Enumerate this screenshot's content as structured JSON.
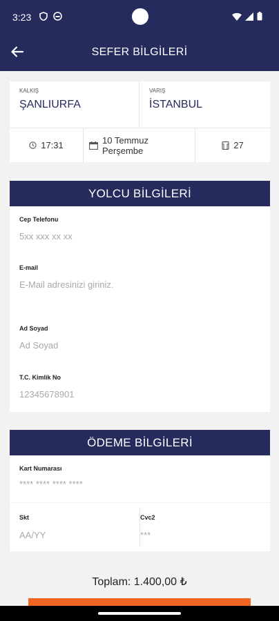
{
  "status_bar": {
    "time": "3:23"
  },
  "app_bar": {
    "title": "SEFER BİLGİLERİ"
  },
  "trip": {
    "from_label": "KALKIŞ",
    "from_city": "ŞANLIURFA",
    "to_label": "VARIŞ",
    "to_city": "İSTANBUL",
    "time": "17:31",
    "date_line1": "10 Temmuz",
    "date_line2": "Perşembe",
    "seat": "27"
  },
  "passenger": {
    "header": "YOLCU BİLGİLERİ",
    "phone_label": "Cep Telefonu",
    "phone_placeholder": "5xx xxx xx xx",
    "email_label": "E-mail",
    "email_placeholder": "E-Mail adresinizi giriniz.",
    "name_label": "Ad Soyad",
    "name_placeholder": "Ad Soyad",
    "tc_label": "T.C. Kimlik No",
    "tc_placeholder": "12345678901"
  },
  "payment": {
    "header": "ÖDEME BİLGİLERİ",
    "card_label": "Kart Numarası",
    "card_placeholder": "**** **** **** ****",
    "expiry_label": "Skt",
    "expiry_placeholder": "AA/YY",
    "cvc_label": "Cvc2",
    "cvc_placeholder": "***"
  },
  "total": "Toplam: 1.400,00 ₺",
  "colors": {
    "primary": "#262b5e",
    "accent": "#f26422",
    "background": "#f2f2f2"
  }
}
